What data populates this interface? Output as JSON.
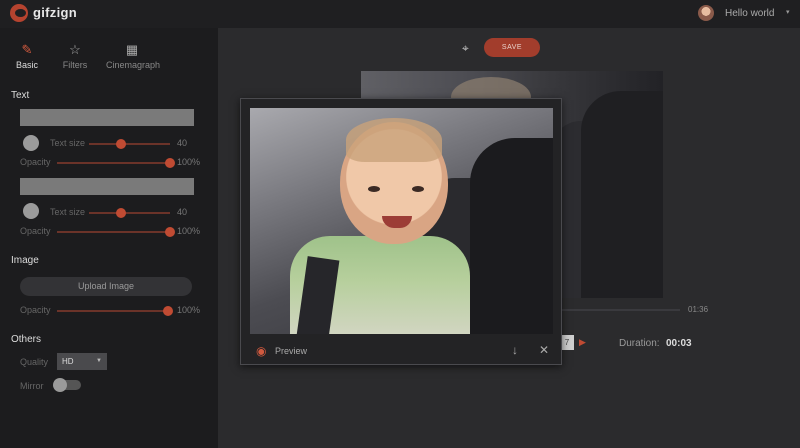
{
  "app": {
    "name": "gifzign"
  },
  "user": {
    "name": "Hello world"
  },
  "tabs": [
    {
      "label": "Basic",
      "icon": "pencil-icon"
    },
    {
      "label": "Filters",
      "icon": "star-icon"
    },
    {
      "label": "Cinemagraph",
      "icon": "film-icon"
    }
  ],
  "text_section": {
    "title": "Text",
    "rows": [
      {
        "text_value": "",
        "size_label": "Text size",
        "size_value": "40",
        "size_level": 0.4,
        "opacity_label": "Opacity",
        "opacity_value": "100%",
        "opacity_level": 1.0
      },
      {
        "text_value": "",
        "size_label": "Text size",
        "size_value": "40",
        "size_level": 0.4,
        "opacity_label": "Opacity",
        "opacity_value": "100%",
        "opacity_level": 1.0
      }
    ]
  },
  "image_section": {
    "title": "Image",
    "upload_label": "Upload Image",
    "opacity_label": "Opacity",
    "opacity_value": "100%",
    "opacity_level": 1.0
  },
  "others_section": {
    "title": "Others",
    "quality_label": "Quality",
    "quality_value": "HD",
    "mirror_label": "Mirror",
    "mirror_on": false
  },
  "toolbar": {
    "save_label": "SAVE"
  },
  "player": {
    "time_end": "01:36",
    "frame_value": "7",
    "duration_label": "Duration:",
    "duration_value": "00:03"
  },
  "preview": {
    "label": "Preview"
  },
  "colors": {
    "accent": "#c04b33",
    "sidebar_bg": "#1c1c1e",
    "main_bg": "#2b2b2d"
  }
}
